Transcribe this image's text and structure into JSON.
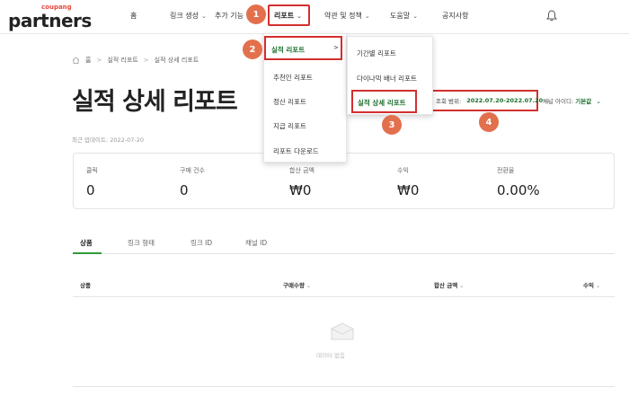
{
  "logo": {
    "small": "coupang",
    "main": "partners"
  },
  "nav": {
    "home": "홈",
    "link_create": "링크 생성",
    "extra": "추가 기능",
    "report": "리포트",
    "terms": "약관 및 정책",
    "help": "도움말",
    "notice": "공지사항"
  },
  "icons": {
    "bell": "bell-icon",
    "home": "home-icon",
    "chevron": "chevron-down-icon",
    "empty": "empty-box-icon"
  },
  "markers": [
    "1",
    "2",
    "3",
    "4"
  ],
  "breadcrumb": [
    "홈",
    "실적 리포트",
    "실적 상세 리포트"
  ],
  "page_title": "실적 상세 리포트",
  "updated": "최근 업데이트: 2022-07-20",
  "date_filter": {
    "label": "조회 범위:",
    "value": "2022.07.20-2022.07.20"
  },
  "channel": {
    "label": "채널 아이디:",
    "value": "기본값"
  },
  "stats": [
    {
      "label": "클릭",
      "value": "0"
    },
    {
      "label": "구매 건수",
      "value": "0"
    },
    {
      "label": "합산 금액",
      "value": "₩0"
    },
    {
      "label": "수익",
      "value": "₩0"
    },
    {
      "label": "전환율",
      "value": "0.00%"
    }
  ],
  "tabs": [
    "상품",
    "링크 형태",
    "링크 ID",
    "채널 ID"
  ],
  "table": {
    "headers": [
      "상품",
      "구매수량",
      "합산 금액",
      "수익"
    ],
    "sort_glyph": "⌄",
    "empty": "데이터 없음"
  },
  "dropdown_report": [
    "실적 리포트",
    "추천인 리포트",
    "정산 리포트",
    "지급 리포트",
    "리포트 다운로드"
  ],
  "dropdown_perf": [
    "기간별 리포트",
    "다이나믹 배너 리포트",
    "실적 상세 리포트"
  ],
  "colors": {
    "accent_green": "#2e9b3c",
    "highlight_red": "#d32f2f",
    "marker_orange": "#e2704c"
  }
}
